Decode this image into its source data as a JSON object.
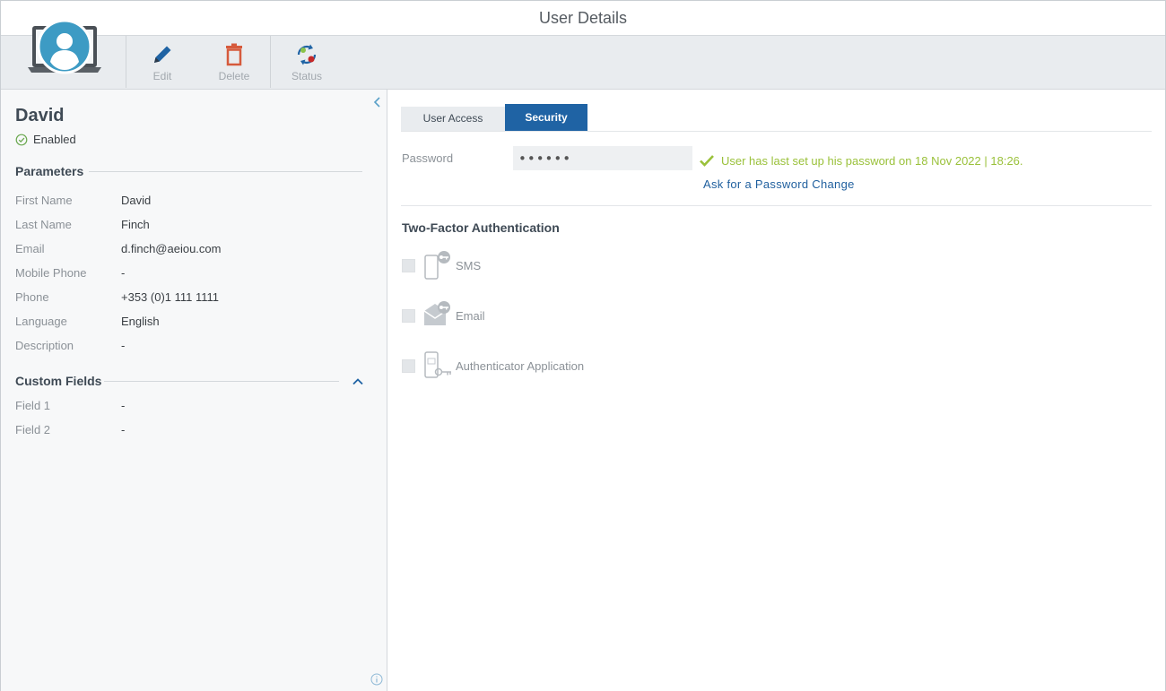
{
  "window": {
    "title": "User Details"
  },
  "toolbar": {
    "edit_label": "Edit",
    "delete_label": "Delete",
    "status_label": "Status"
  },
  "user": {
    "name": "David",
    "status": "Enabled"
  },
  "parameters": {
    "heading": "Parameters",
    "rows": [
      {
        "key": "First Name",
        "value": "David"
      },
      {
        "key": "Last Name",
        "value": "Finch"
      },
      {
        "key": "Email",
        "value": "d.finch@aeiou.com"
      },
      {
        "key": "Mobile Phone",
        "value": "-"
      },
      {
        "key": "Phone",
        "value": "+353 (0)1 111 1111"
      },
      {
        "key": "Language",
        "value": "English"
      },
      {
        "key": "Description",
        "value": "-"
      }
    ]
  },
  "custom_fields": {
    "heading": "Custom Fields",
    "rows": [
      {
        "key": "Field 1",
        "value": "-"
      },
      {
        "key": "Field 2",
        "value": "-"
      }
    ]
  },
  "tabs": [
    {
      "label": "User Access",
      "active": false
    },
    {
      "label": "Security",
      "active": true
    }
  ],
  "security": {
    "password_label": "Password",
    "password_value": "••••••",
    "password_message": "User has last set up his password on 18 Nov 2022 | 18:26.",
    "password_change_link": "Ask for a Password Change",
    "tfa_title": "Two-Factor Authentication",
    "tfa_options": [
      {
        "label": "SMS",
        "icon": "sms-key-icon",
        "checked": false
      },
      {
        "label": "Email",
        "icon": "email-key-icon",
        "checked": false
      },
      {
        "label": "Authenticator Application",
        "icon": "authenticator-app-icon",
        "checked": false
      }
    ]
  },
  "colors": {
    "accent": "#1f63a4",
    "success": "#9ac13a",
    "delete": "#d65a3c",
    "avatar": "#3d9bc4"
  }
}
